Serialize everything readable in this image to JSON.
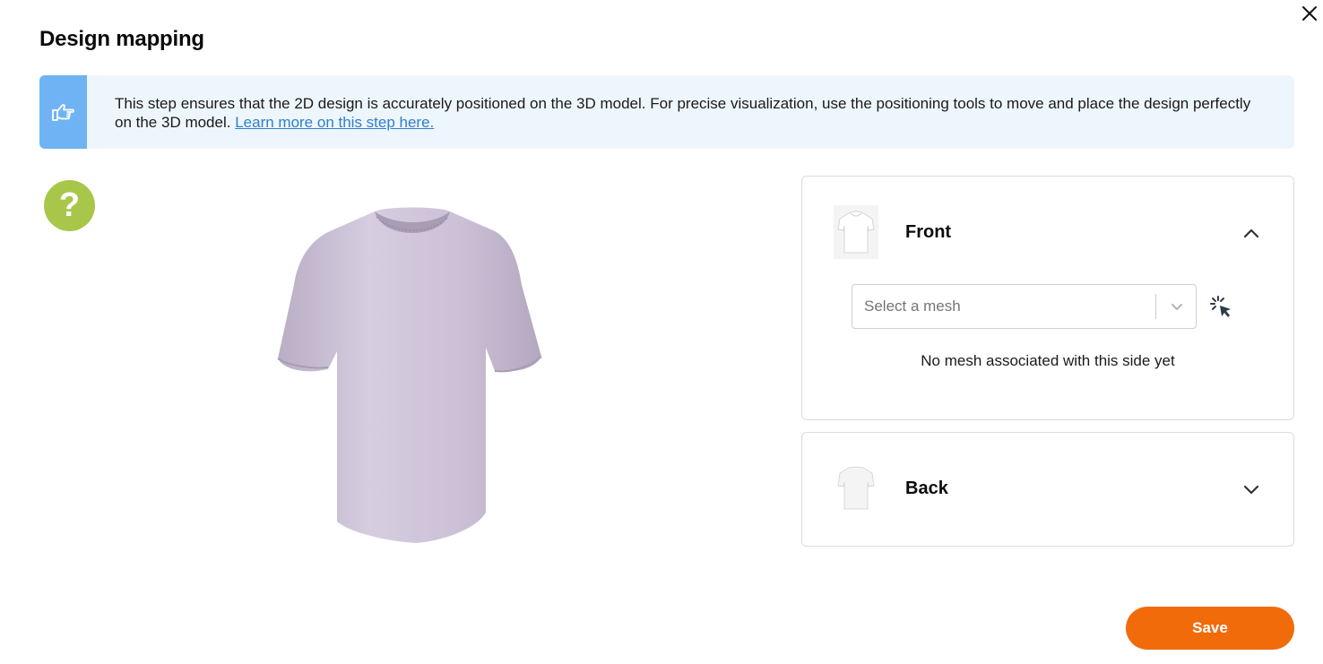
{
  "dialog": {
    "title": "Design mapping",
    "save_label": "Save"
  },
  "info": {
    "text": "This step ensures that the 2D design is accurately positioned on the 3D model. For precise visualization, use the positioning tools to move and place the design perfectly on the 3D model.",
    "link_text": "Learn more on this step here.",
    "accent_color": "#6fb3f5",
    "icon": "hand-pointing-icon"
  },
  "help": {
    "label": "?",
    "color": "#a8c74a"
  },
  "model": {
    "shirt_color": "#cfc5d8"
  },
  "sides": {
    "front": {
      "label": "Front",
      "expanded": true,
      "mesh_placeholder": "Select a mesh",
      "empty_message": "No mesh associated with this side yet"
    },
    "back": {
      "label": "Back",
      "expanded": false
    }
  },
  "colors": {
    "save": "#f26b0a",
    "link": "#2f7fcc"
  }
}
